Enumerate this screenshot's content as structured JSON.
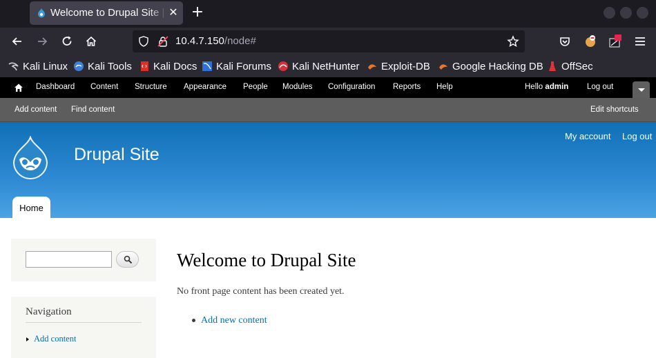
{
  "browser": {
    "tab_title": "Welcome to Drupal Site | Drupal Site",
    "url_host": "10.4.7.150",
    "url_path": "/node#",
    "bookmarks": [
      {
        "label": "Kali Linux",
        "icon": "kali-dragon-icon"
      },
      {
        "label": "Kali Tools",
        "icon": "kali-tools-icon"
      },
      {
        "label": "Kali Docs",
        "icon": "kali-docs-icon"
      },
      {
        "label": "Kali Forums",
        "icon": "kali-forums-icon"
      },
      {
        "label": "Kali NetHunter",
        "icon": "nethunter-icon"
      },
      {
        "label": "Exploit-DB",
        "icon": "exploit-db-icon"
      },
      {
        "label": "Google Hacking DB",
        "icon": "ghdb-icon"
      },
      {
        "label": "OffSec",
        "icon": "offsec-icon"
      }
    ],
    "extension_badge": "2"
  },
  "toolbar": {
    "menu": [
      "Dashboard",
      "Content",
      "Structure",
      "Appearance",
      "People",
      "Modules",
      "Configuration",
      "Reports",
      "Help"
    ],
    "hello": "Hello",
    "user": "admin",
    "logout": "Log out"
  },
  "shortcuts": {
    "add_content": "Add content",
    "find_content": "Find content",
    "edit_shortcuts": "Edit shortcuts"
  },
  "header": {
    "site_name": "Drupal Site",
    "my_account": "My account",
    "log_out": "Log out",
    "home_tab": "Home"
  },
  "sidebar": {
    "search_value": "",
    "navigation_title": "Navigation",
    "nav_items": [
      "Add content"
    ]
  },
  "main": {
    "title": "Welcome to Drupal Site",
    "text": "No front page content has been created yet.",
    "link": "Add new content"
  },
  "colors": {
    "header_blue": "#0f70b6",
    "link": "#0071b3",
    "toolbar": "#000000"
  }
}
